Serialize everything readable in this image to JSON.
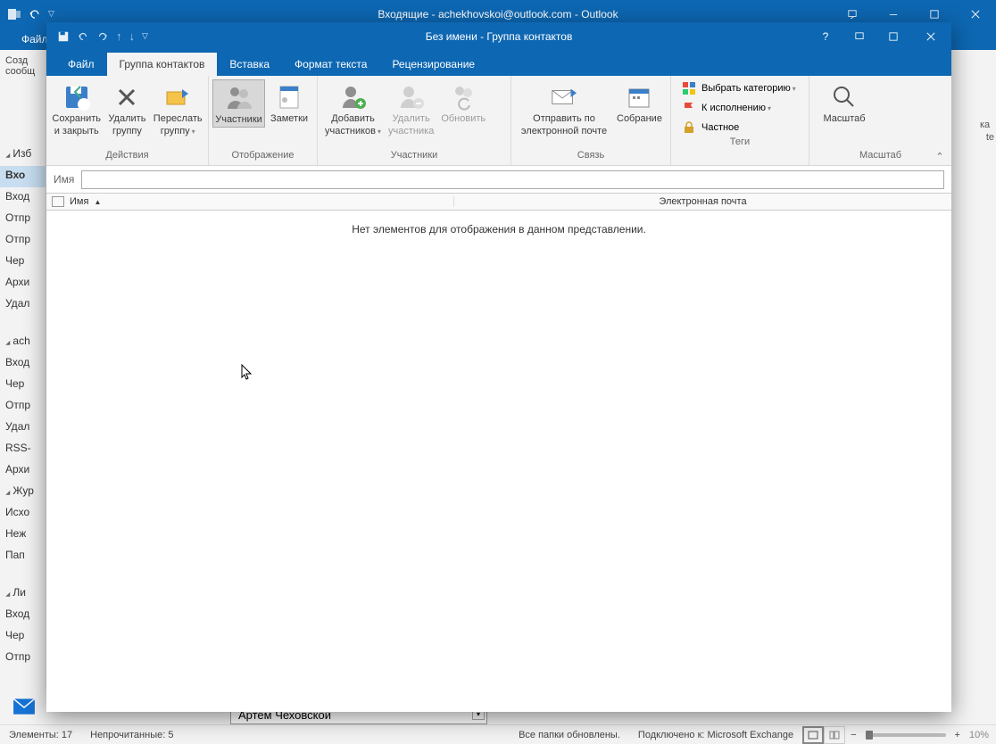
{
  "outer_window": {
    "title": "Входящие - achekhovskoi@outlook.com -  Outlook",
    "file_tab": "Файл",
    "create_btn_partial": "Созд",
    "create_btn_partial2": "сообщ"
  },
  "folders": {
    "favorites_header": "Изб",
    "inbox_sel": "Вхо",
    "items": [
      "Вход",
      "Отпр",
      "Отпр",
      "Чер",
      "Архи",
      "Удал"
    ],
    "account_header": "ach",
    "account_items": [
      "Вход",
      "Чер",
      "Отпр",
      "Удал",
      "RSS-",
      "Архи",
      "Жур",
      "Исхо",
      "Неж",
      "Пап"
    ],
    "personal_header": "Ли",
    "personal_items": [
      "Вход",
      "Чер",
      "Отпр"
    ]
  },
  "right_slice": {
    "ka": "ка",
    "te": "te"
  },
  "name_peek": "Артем Чеховской",
  "status_bar": {
    "items": "Элементы: 17",
    "unread": "Непрочитанные: 5",
    "sync": "Все папки обновлены.",
    "conn": "Подключено к: Microsoft Exchange",
    "zoom_pct": "10%"
  },
  "dialog": {
    "title": "Без имени  -  Группа контактов",
    "tabs": {
      "file": "Файл",
      "group": "Группа контактов",
      "insert": "Вставка",
      "format": "Формат текста",
      "review": "Рецензирование"
    },
    "ribbon": {
      "actions": {
        "label": "Действия",
        "save_close_line1": "Сохранить",
        "save_close_line2": "и закрыть",
        "delete_line1": "Удалить",
        "delete_line2": "группу",
        "forward_line1": "Переслать",
        "forward_line2": "группу"
      },
      "display": {
        "label": "Отображение",
        "members": "Участники",
        "notes": "Заметки"
      },
      "members": {
        "label": "Участники",
        "add_line1": "Добавить",
        "add_line2": "участников",
        "remove_line1": "Удалить",
        "remove_line2": "участника",
        "update": "Обновить"
      },
      "comm": {
        "label": "Связь",
        "email_line1": "Отправить по",
        "email_line2": "электронной почте",
        "meeting": "Собрание"
      },
      "tags": {
        "label": "Теги",
        "category": "Выбрать категорию",
        "followup": "К исполнению",
        "private": "Частное"
      },
      "zoom": {
        "label": "Масштаб",
        "btn": "Масштаб"
      }
    },
    "name_field_label": "Имя",
    "list_header": {
      "name": "Имя",
      "email": "Электронная почта"
    },
    "empty_msg": "Нет элементов для отображения в данном представлении."
  }
}
